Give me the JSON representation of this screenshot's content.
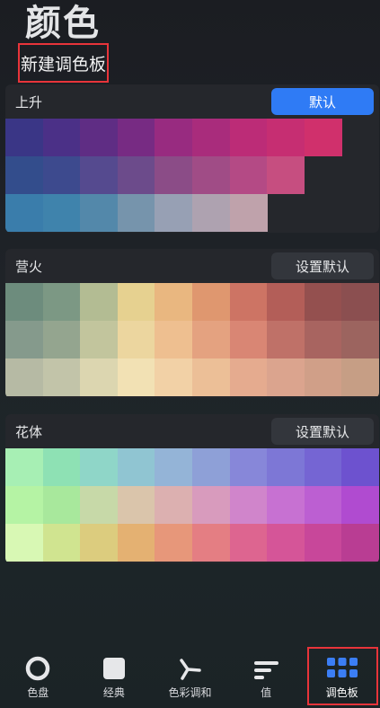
{
  "header": {
    "title": "颜色",
    "new_palette": "新建调色板"
  },
  "palettes": [
    {
      "name": "上升",
      "action": "默认",
      "is_default": true,
      "rows": [
        [
          "#3a3686",
          "#4b3087",
          "#5f2d84",
          "#772b83",
          "#982b80",
          "#a92c7c",
          "#bc2c77",
          "#c62e72",
          "#d0306c"
        ],
        [
          "#334d8c",
          "#3d4a8e",
          "#554a8f",
          "#6c4b8b",
          "#8b4c87",
          "#a04c86",
          "#b44a85",
          "#c64e80"
        ],
        [
          "#3a7dab",
          "#3f83ac",
          "#5388aa",
          "#7694ac",
          "#97a0b4",
          "#aea2b0",
          "#bfa2ab"
        ]
      ]
    },
    {
      "name": "营火",
      "action": "设置默认",
      "is_default": false,
      "rows": [
        [
          "#6d8c7d",
          "#7c9884",
          "#b3bc93",
          "#e6d190",
          "#e9b780",
          "#df976f",
          "#cd7464",
          "#b35e58",
          "#94504f",
          "#8b4f50"
        ],
        [
          "#859a8c",
          "#94a58f",
          "#c2c59d",
          "#ecd69f",
          "#eebf90",
          "#e4a280",
          "#d98674",
          "#bf7168",
          "#a86460",
          "#9c645f"
        ],
        [
          "#b6baa4",
          "#c2c4a9",
          "#dcd6b0",
          "#f2e1b4",
          "#f2d1a6",
          "#ecbf97",
          "#e5ab8f",
          "#dba48e",
          "#d09f88",
          "#c69e85"
        ]
      ]
    },
    {
      "name": "花体",
      "action": "设置默认",
      "is_default": false,
      "rows": [
        [
          "#a7efb4",
          "#8ee1b4",
          "#8fd6c8",
          "#90c5d2",
          "#94b4d7",
          "#8ea0d7",
          "#8787d9",
          "#7d77d6",
          "#7565d3",
          "#6d52cf"
        ],
        [
          "#b5f3a4",
          "#a8e89c",
          "#c7d9a8",
          "#dac5ab",
          "#dcb0b0",
          "#d89bbd",
          "#d085cb",
          "#c771d2",
          "#bc5fd2",
          "#b04bd0"
        ],
        [
          "#d8f8b4",
          "#d0e490",
          "#dccc7e",
          "#e4b172",
          "#e7977a",
          "#e47e83",
          "#dd6590",
          "#d55598",
          "#c8479a",
          "#b93d93"
        ]
      ]
    }
  ],
  "nav": [
    {
      "label": "色盘",
      "icon": "color-wheel-icon",
      "active": false
    },
    {
      "label": "经典",
      "icon": "square-icon",
      "active": false
    },
    {
      "label": "色彩调和",
      "icon": "harmony-icon",
      "active": false
    },
    {
      "label": "值",
      "icon": "value-bars-icon",
      "active": false
    },
    {
      "label": "调色板",
      "icon": "palette-grid-icon",
      "active": true
    }
  ]
}
